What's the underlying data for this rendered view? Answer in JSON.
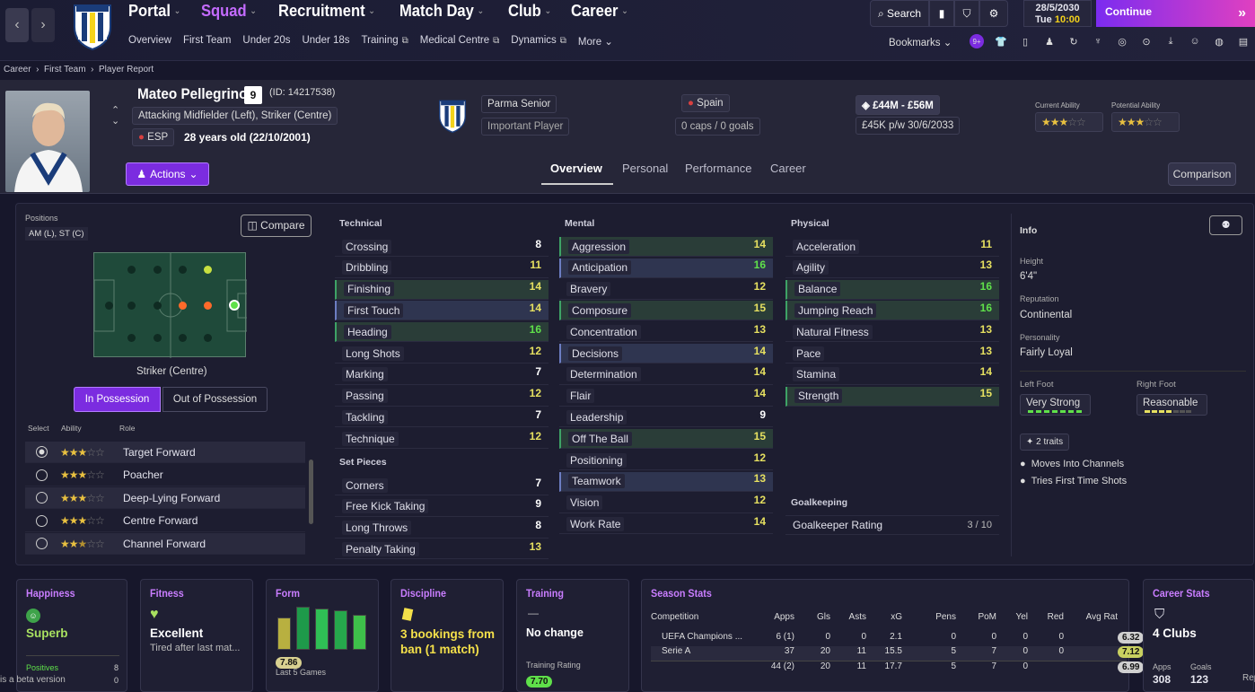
{
  "nav": {
    "main": [
      "Portal",
      "Squad",
      "Recruitment",
      "Match Day",
      "Club",
      "Career"
    ],
    "sub": [
      "Overview",
      "First Team",
      "Under 20s",
      "Under 18s",
      "Training",
      "Medical Centre",
      "Dynamics",
      "More"
    ],
    "search": "Search",
    "date": "28/5/2030",
    "day_time": "Tue",
    "time": "10:00",
    "continue": "Continue",
    "bookmarks": "Bookmarks",
    "badge": "9+"
  },
  "breadcrumb": [
    "Career",
    "First Team",
    "Player Report"
  ],
  "player": {
    "name": "Mateo Pellegrino",
    "number": "9",
    "id": "(ID: 14217538)",
    "position": "Attacking Midfielder (Left), Striker (Centre)",
    "nat_code": "ESP",
    "age": "28 years old (22/10/2001)",
    "club": "Parma Senior",
    "status": "Important Player",
    "nation": "Spain",
    "caps": "0 caps / 0 goals",
    "value": "£44M - £56M",
    "wage": "£45K p/w 30/6/2033",
    "ca_label": "Current Ability",
    "pa_label": "Potential Ability",
    "actions": "Actions"
  },
  "tabs": [
    "Overview",
    "Personal",
    "Performance",
    "Career"
  ],
  "comparison": "Comparison",
  "positions": {
    "label": "Positions",
    "value": "AM (L), ST (C)",
    "compare": "Compare",
    "role_pos": "Striker (Centre)",
    "in_poss": "In Possession",
    "out_poss": "Out of Possession",
    "hdr_select": "Select",
    "hdr_ability": "Ability",
    "hdr_role": "Role",
    "roles": [
      {
        "name": "Target Forward",
        "stars": 3
      },
      {
        "name": "Poacher",
        "stars": 3
      },
      {
        "name": "Deep-Lying Forward",
        "stars": 3
      },
      {
        "name": "Centre Forward",
        "stars": 3
      },
      {
        "name": "Channel Forward",
        "stars": 2.5
      }
    ]
  },
  "technical": {
    "title": "Technical",
    "items": [
      [
        "Crossing",
        "8"
      ],
      [
        "Dribbling",
        "11"
      ],
      [
        "Finishing",
        "14"
      ],
      [
        "First Touch",
        "14"
      ],
      [
        "Heading",
        "16"
      ],
      [
        "Long Shots",
        "12"
      ],
      [
        "Marking",
        "7"
      ],
      [
        "Passing",
        "12"
      ],
      [
        "Tackling",
        "7"
      ],
      [
        "Technique",
        "12"
      ]
    ]
  },
  "setpieces": {
    "title": "Set Pieces",
    "items": [
      [
        "Corners",
        "7"
      ],
      [
        "Free Kick Taking",
        "9"
      ],
      [
        "Long Throws",
        "8"
      ],
      [
        "Penalty Taking",
        "13"
      ]
    ]
  },
  "mental": {
    "title": "Mental",
    "items": [
      [
        "Aggression",
        "14"
      ],
      [
        "Anticipation",
        "16"
      ],
      [
        "Bravery",
        "12"
      ],
      [
        "Composure",
        "15"
      ],
      [
        "Concentration",
        "13"
      ],
      [
        "Decisions",
        "14"
      ],
      [
        "Determination",
        "14"
      ],
      [
        "Flair",
        "14"
      ],
      [
        "Leadership",
        "9"
      ],
      [
        "Off The Ball",
        "15"
      ],
      [
        "Positioning",
        "12"
      ],
      [
        "Teamwork",
        "13"
      ],
      [
        "Vision",
        "12"
      ],
      [
        "Work Rate",
        "14"
      ]
    ]
  },
  "physical": {
    "title": "Physical",
    "items": [
      [
        "Acceleration",
        "11"
      ],
      [
        "Agility",
        "13"
      ],
      [
        "Balance",
        "16"
      ],
      [
        "Jumping Reach",
        "16"
      ],
      [
        "Natural Fitness",
        "13"
      ],
      [
        "Pace",
        "13"
      ],
      [
        "Stamina",
        "14"
      ],
      [
        "Strength",
        "15"
      ]
    ]
  },
  "goalkeeping": {
    "title": "Goalkeeping",
    "label": "Goalkeeper Rating",
    "value": "3 / 10"
  },
  "info": {
    "title": "Info",
    "height_l": "Height",
    "height": "6'4\"",
    "rep_l": "Reputation",
    "rep": "Continental",
    "pers_l": "Personality",
    "pers": "Fairly Loyal",
    "lf_l": "Left Foot",
    "lf": "Very Strong",
    "rf_l": "Right Foot",
    "rf": "Reasonable",
    "traits": "2 traits",
    "trait_list": [
      "Moves Into Channels",
      "Tries First Time Shots"
    ]
  },
  "cards": {
    "happiness": {
      "title": "Happiness",
      "value": "Superb",
      "pos_l": "Positives",
      "pos": "8",
      "neg": "0",
      "overlay": "is a beta version"
    },
    "fitness": {
      "title": "Fitness",
      "value": "Excellent",
      "sub": "Tired after last mat..."
    },
    "form": {
      "title": "Form",
      "rating": "7.86",
      "sub": "Last 5 Games"
    },
    "discipline": {
      "title": "Discipline",
      "value": "3 bookings from ban (1 match)"
    },
    "training": {
      "title": "Training",
      "dash": "—",
      "value": "No change",
      "rating_l": "Training Rating",
      "rating": "7.70"
    },
    "season": {
      "title": "Season Stats",
      "headers": [
        "Competition",
        "Apps",
        "Gls",
        "Asts",
        "xG",
        "Pens",
        "PoM",
        "Yel",
        "Red",
        "Avg Rat"
      ],
      "rows": [
        [
          "UEFA Champions ...",
          "6 (1)",
          "0",
          "0",
          "2.1",
          "0",
          "0",
          "0",
          "0",
          "6.32"
        ],
        [
          "Serie A",
          "37",
          "20",
          "11",
          "15.5",
          "5",
          "7",
          "0",
          "0",
          "7.12"
        ],
        [
          "",
          "44 (2)",
          "20",
          "11",
          "17.7",
          "5",
          "7",
          "0",
          "",
          "6.99"
        ]
      ]
    },
    "career": {
      "title": "Career Stats",
      "value": "4 Clubs",
      "apps_l": "Apps",
      "apps": "308",
      "goals_l": "Goals",
      "goals": "123",
      "rep": "Rep"
    }
  }
}
